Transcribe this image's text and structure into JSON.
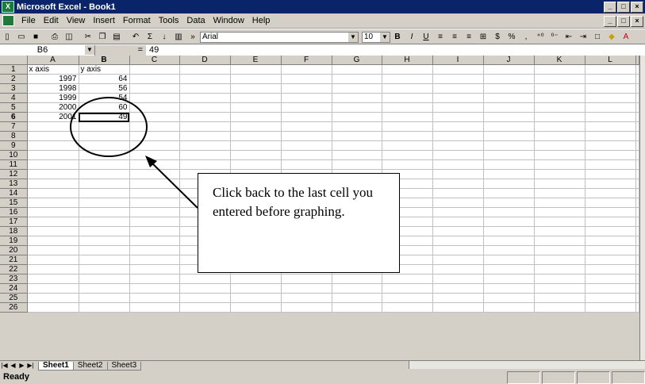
{
  "window": {
    "title": "Microsoft Excel - Book1",
    "controls": [
      "_",
      "□",
      "×"
    ]
  },
  "menu": [
    "File",
    "Edit",
    "View",
    "Insert",
    "Format",
    "Tools",
    "Data",
    "Window",
    "Help"
  ],
  "toolbar": {
    "font_name": "Arial",
    "font_size": "10",
    "percent_symbol": "%",
    "currency_symbol": "$",
    "comma_symbol": ","
  },
  "formula_bar": {
    "cell_ref": "B6",
    "equals": "=",
    "value": "49"
  },
  "columns": [
    "A",
    "B",
    "C",
    "D",
    "E",
    "F",
    "G",
    "H",
    "I",
    "J",
    "K",
    "L"
  ],
  "rows": [
    "1",
    "2",
    "3",
    "4",
    "5",
    "6",
    "7",
    "8",
    "9",
    "10",
    "11",
    "12",
    "13",
    "14",
    "15",
    "16",
    "17",
    "18",
    "19",
    "20",
    "21",
    "22",
    "23",
    "24",
    "25",
    "26"
  ],
  "cells": {
    "A1": "x axis",
    "B1": "y axis",
    "A2": "1997",
    "B2": "64",
    "A3": "1998",
    "B3": "56",
    "A4": "1999",
    "B4": "54",
    "A5": "2000",
    "B5": "60",
    "A6": "2001",
    "B6": "49"
  },
  "sheets": [
    "Sheet1",
    "Sheet2",
    "Sheet3"
  ],
  "active_sheet": "Sheet1",
  "status": "Ready",
  "callout_text": "Click back to the last cell you entered before graphing.",
  "colors": {
    "titlebar": "#0a246a",
    "chrome": "#d4d0c8",
    "grid_line": "#c0c0c0"
  }
}
